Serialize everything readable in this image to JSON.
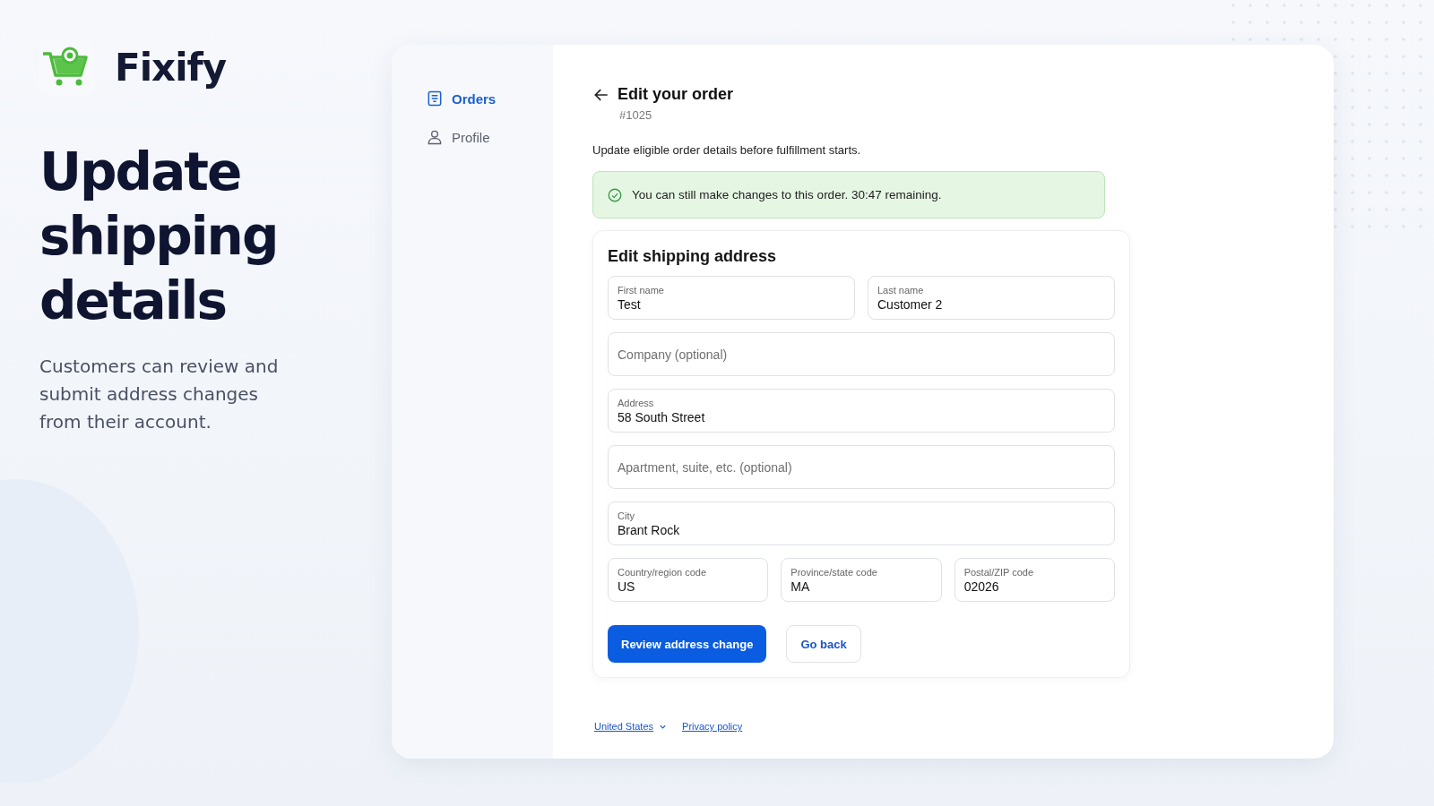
{
  "brand": {
    "name": "Fixify"
  },
  "hero": {
    "title": "Update shipping details",
    "description": "Customers can review and submit address changes from their account."
  },
  "sidebar": {
    "items": [
      {
        "label": "Orders",
        "kind": "orders",
        "selected": true
      },
      {
        "label": "Profile",
        "kind": "profile",
        "selected": false
      }
    ]
  },
  "page": {
    "title": "Edit your order",
    "order_number": "#1025",
    "description": "Update eligible order details before fulfillment starts."
  },
  "notice": {
    "text": "You can still make changes to this order. 30:47 remaining."
  },
  "form": {
    "title": "Edit shipping address",
    "rows": [
      [
        {
          "label": "First name",
          "value": "Test"
        },
        {
          "label": "Last name",
          "value": "Customer 2"
        }
      ],
      [
        {
          "placeholder": "Company (optional)"
        }
      ],
      [
        {
          "label": "Address",
          "value": "58 South Street"
        }
      ],
      [
        {
          "placeholder": "Apartment, suite, etc. (optional)"
        }
      ],
      [
        {
          "label": "City",
          "value": "Brant Rock"
        }
      ],
      [
        {
          "label": "Country/region code",
          "value": "US"
        },
        {
          "label": "Province/state code",
          "value": "MA"
        },
        {
          "label": "Postal/ZIP code",
          "value": "02026"
        }
      ]
    ],
    "buttons": [
      {
        "label": "Review address change",
        "kind": "primary"
      },
      {
        "label": "Go back",
        "kind": "secondary"
      }
    ]
  },
  "footer": {
    "region": "United States",
    "links": [
      "Privacy policy"
    ]
  }
}
